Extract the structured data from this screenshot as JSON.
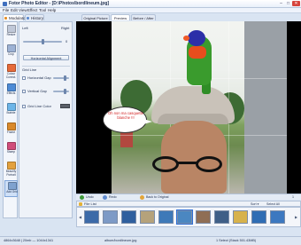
{
  "window": {
    "title": "Fotor Photo Editor - [D:\\Photos\\bordlineum.jpg]",
    "controls": {
      "minimize": "–",
      "maximize": "□",
      "close": "✕"
    }
  },
  "menu": [
    "File",
    "Edit",
    "View",
    "Effect",
    "Tool",
    "Help"
  ],
  "left_tabs": [
    {
      "label": "Modulator",
      "icon": "wrench-icon"
    },
    {
      "label": "History",
      "icon": "history-icon"
    }
  ],
  "tools": [
    {
      "label": "Resize",
      "icon": "resize-icon",
      "color": "#c0c8d8"
    },
    {
      "label": "Crop",
      "icon": "crop-icon",
      "color": "#9db2d4"
    },
    {
      "label": "Colour Correct.",
      "icon": "color-correct-icon",
      "color": "#e66a39"
    },
    {
      "label": "Effects",
      "icon": "effects-icon",
      "color": "#4d8bd6"
    },
    {
      "label": "Bubble",
      "icon": "bubble-icon",
      "color": "#6cb5e8"
    },
    {
      "label": "Frame",
      "icon": "frame-icon",
      "color": "#d9892a"
    },
    {
      "label": "Stamp",
      "icon": "stamp-icon",
      "color": "#d04d7a"
    },
    {
      "label": "Beautify Portrait",
      "icon": "beautify-icon",
      "color": "#e3a13d"
    },
    {
      "label": "Add Grid",
      "icon": "grid-icon",
      "color": "#7fa2cf"
    }
  ],
  "settings": {
    "left_label": "Left",
    "right_label": "Right",
    "value": "0",
    "level": 0.5,
    "button": "Horizontal Alignment",
    "section": "Grid Line",
    "horizontal_gap": "Horizontal Gap",
    "vertical_gap": "Vertical Gap",
    "grid_color": "Grid Line Color",
    "horizontal_level": 0.75,
    "vertical_level": 0.75
  },
  "view_tabs": [
    "Original Picture",
    "Preview",
    "Before / After"
  ],
  "bubble_text": "Oh non ma casquette blanche !!!",
  "canvas_strip": {
    "undo": "Undo",
    "redo": "Redo",
    "back": "Back to Original",
    "page": "1"
  },
  "file_list": {
    "title": "File List",
    "prev": "◀",
    "next": "▶",
    "sort": "Sort ▾",
    "select": "Select All",
    "thumb_colors": [
      "#3c6aa8",
      "#7d9ac6",
      "#2f5f9e",
      "#b5a27b",
      "#3e79b8",
      "#4b87c1",
      "#8f6e55",
      "#3f5f87",
      "#d7b24c",
      "#2f6db4",
      "#3c78c0"
    ]
  },
  "status": {
    "left": "4864x3648 | 20mb — 1044x1341",
    "mid": "album/bordlineum.jpg",
    "right": "1 Select (Stack 501.43MB)"
  }
}
